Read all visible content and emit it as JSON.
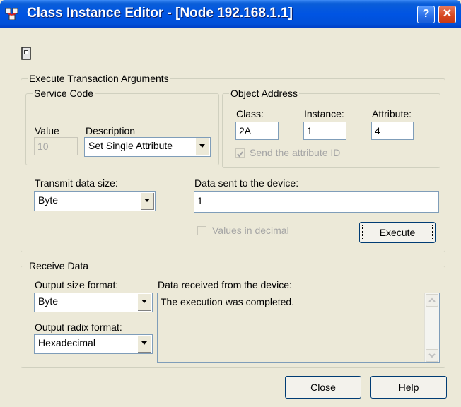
{
  "window": {
    "title": "Class Instance Editor - [Node 192.168.1.1]",
    "help_glyph": "?",
    "close_glyph": "✕"
  },
  "execute_group": {
    "label": "Execute Transaction Arguments",
    "service_code": {
      "label": "Service Code",
      "value_label": "Value",
      "value": "10",
      "description_label": "Description",
      "description_selected": "Set Single Attribute"
    },
    "object_address": {
      "label": "Object Address",
      "class_label": "Class:",
      "class_value": "2A",
      "instance_label": "Instance:",
      "instance_value": "1",
      "attribute_label": "Attribute:",
      "attribute_value": "4",
      "send_attr_label": "Send the attribute ID",
      "send_attr_checked": true
    },
    "transmit_label": "Transmit data size:",
    "transmit_selected": "Byte",
    "data_sent_label": "Data sent to the device:",
    "data_sent_value": "1",
    "values_decimal_label": "Values in decimal",
    "execute_button": "Execute"
  },
  "receive_group": {
    "label": "Receive Data",
    "output_size_label": "Output size format:",
    "output_size_selected": "Byte",
    "output_radix_label": "Output radix format:",
    "output_radix_selected": "Hexadecimal",
    "data_received_label": "Data received from the device:",
    "data_received_text": "The execution was completed."
  },
  "footer": {
    "close_button": "Close",
    "help_button": "Help"
  }
}
